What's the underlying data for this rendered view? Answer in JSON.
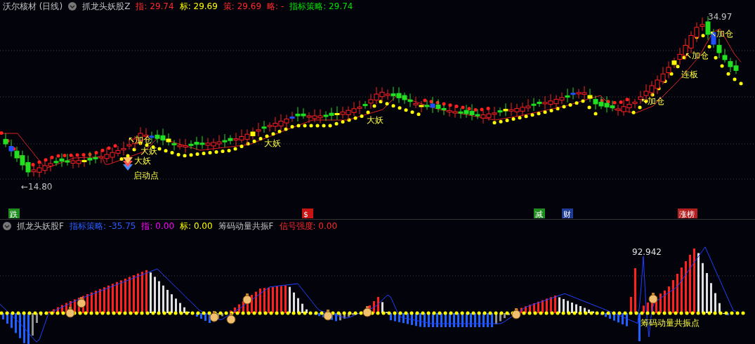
{
  "main_panel": {
    "stock": "沃尔核材 (日线)",
    "indicator": "抓龙头妖股Z",
    "readings": [
      {
        "text": "指: 29.74",
        "color": "#ff2a2a"
      },
      {
        "text": "标: 29.69",
        "color": "#ffff00"
      },
      {
        "text": "策: 29.69",
        "color": "#ff2a2a"
      },
      {
        "text": "略: -",
        "color": "#ff2a2a"
      },
      {
        "text": "指标策略: 29.74",
        "color": "#00e000"
      }
    ],
    "annotations": [
      {
        "text": "↖加仓",
        "kind": "signal"
      },
      {
        "text": "大妖",
        "kind": "signal"
      },
      {
        "text": "大妖",
        "kind": "signal"
      },
      {
        "text": "启动点",
        "kind": "signal"
      },
      {
        "text": "大妖",
        "kind": "signal"
      },
      {
        "text": "大妖",
        "kind": "signal"
      },
      {
        "text": "↖加仓",
        "kind": "signal"
      },
      {
        "text": "连板",
        "kind": "signal"
      },
      {
        "text": "↖加仓",
        "kind": "signal"
      },
      {
        "text": "↖加仓",
        "kind": "signal"
      },
      {
        "text": "34.97",
        "kind": "price"
      },
      {
        "text": "←14.80",
        "kind": "price"
      }
    ],
    "signals": [
      {
        "text": "跌",
        "color": "#1e8c1e"
      },
      {
        "text": "$",
        "color": "#c81414"
      },
      {
        "text": "减",
        "color": "#1e8c1e"
      },
      {
        "text": "财",
        "color": "#1e3c96"
      },
      {
        "text": "涨榜",
        "color": "#b41e1e"
      }
    ]
  },
  "sub_panel": {
    "indicator": "抓龙头妖股F",
    "readings": [
      {
        "text": "指标策略: -35.75",
        "color": "#2a5cff"
      },
      {
        "text": "指: 0.00",
        "color": "#ff00ff"
      },
      {
        "text": "标: 0.00",
        "color": "#ffff00"
      },
      {
        "text": "筹码动量共振F",
        "color": "#c0c0c0"
      },
      {
        "text": "信号强度: 0.00",
        "color": "#ff2a2a"
      }
    ],
    "annotations": [
      {
        "text": "92.942",
        "kind": "price"
      },
      {
        "text": "筹码动量共振点",
        "kind": "signal"
      }
    ]
  }
}
